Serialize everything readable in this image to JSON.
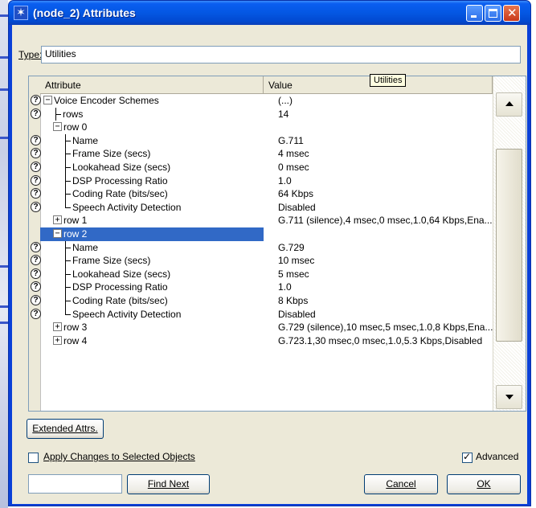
{
  "window": {
    "title": "(node_2) Attributes"
  },
  "type_field": {
    "label": "Type:",
    "value": "Utilities"
  },
  "grid": {
    "headers": {
      "attribute": "Attribute",
      "value": "Value"
    },
    "tooltip": "Utilities",
    "rows": [
      {
        "depth": 0,
        "expander": "minus",
        "help": true,
        "label": "Voice Encoder Schemes",
        "value": "(...)"
      },
      {
        "depth": 1,
        "expander": "none",
        "help": true,
        "label": "rows",
        "value": "14"
      },
      {
        "depth": 1,
        "expander": "minus",
        "help": false,
        "label": "row 0",
        "value": ""
      },
      {
        "depth": 2,
        "expander": "none",
        "help": true,
        "label": "Name",
        "value": "G.711"
      },
      {
        "depth": 2,
        "expander": "none",
        "help": true,
        "label": "Frame Size (secs)",
        "value": "4 msec"
      },
      {
        "depth": 2,
        "expander": "none",
        "help": true,
        "label": "Lookahead Size (secs)",
        "value": "0 msec"
      },
      {
        "depth": 2,
        "expander": "none",
        "help": true,
        "label": "DSP Processing Ratio",
        "value": "1.0"
      },
      {
        "depth": 2,
        "expander": "none",
        "help": true,
        "label": "Coding Rate (bits/sec)",
        "value": "64 Kbps"
      },
      {
        "depth": 2,
        "expander": "none",
        "help": true,
        "label": "Speech Activity Detection",
        "value": "Disabled",
        "last": true
      },
      {
        "depth": 1,
        "expander": "plus",
        "help": false,
        "label": "row 1",
        "value": "G.711 (silence),4 msec,0 msec,1.0,64 Kbps,Ena..."
      },
      {
        "depth": 1,
        "expander": "minus",
        "help": false,
        "label": "row 2",
        "value": "",
        "selected": true
      },
      {
        "depth": 2,
        "expander": "none",
        "help": true,
        "label": "Name",
        "value": "G.729"
      },
      {
        "depth": 2,
        "expander": "none",
        "help": true,
        "label": "Frame Size (secs)",
        "value": "10 msec"
      },
      {
        "depth": 2,
        "expander": "none",
        "help": true,
        "label": "Lookahead Size (secs)",
        "value": "5 msec"
      },
      {
        "depth": 2,
        "expander": "none",
        "help": true,
        "label": "DSP Processing Ratio",
        "value": "1.0"
      },
      {
        "depth": 2,
        "expander": "none",
        "help": true,
        "label": "Coding Rate (bits/sec)",
        "value": "8 Kbps"
      },
      {
        "depth": 2,
        "expander": "none",
        "help": true,
        "label": "Speech Activity Detection",
        "value": "Disabled",
        "last": true
      },
      {
        "depth": 1,
        "expander": "plus",
        "help": false,
        "label": "row 3",
        "value": "G.729 (silence),10 msec,5 msec,1.0,8 Kbps,Ena..."
      },
      {
        "depth": 1,
        "expander": "plus",
        "help": false,
        "label": "row 4",
        "value": "G.723.1,30 msec,0 msec,1.0,5.3 Kbps,Disabled"
      }
    ]
  },
  "buttons": {
    "extended_attrs": "Extended Attrs.",
    "find_next": "Find Next",
    "cancel": "Cancel",
    "ok": "OK"
  },
  "checkboxes": {
    "apply_changes": {
      "label": "Apply Changes to Selected Objects",
      "checked": false
    },
    "advanced": {
      "label": "Advanced",
      "checked": true
    }
  },
  "find_field": {
    "value": ""
  },
  "colors": {
    "titlebar": "#0a5ef0",
    "selection": "#3169c6",
    "dialog_bg": "#ece9d8"
  }
}
